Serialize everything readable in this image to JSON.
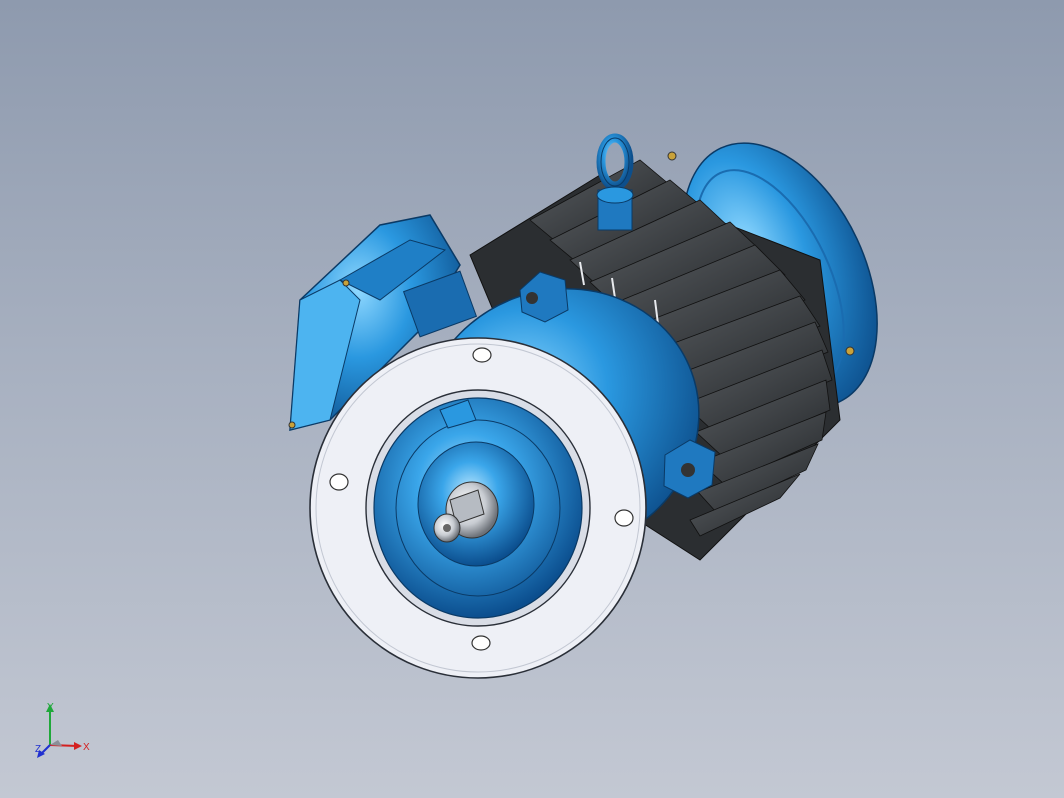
{
  "viewport": {
    "background_top": "#8e9aae",
    "background_bottom": "#c3c8d3"
  },
  "model": {
    "body_color": "#2a8fd6",
    "body_highlight": "#6cc6f5",
    "fin_color": "#3a3d40",
    "flange_color": "#eef0f6",
    "shaft_color": "#cfd3d8",
    "components": [
      "flange",
      "fan-cover",
      "cooling-fins",
      "terminal-box",
      "lifting-eye",
      "shaft",
      "bearing-cap",
      "mounting-holes"
    ]
  },
  "triad": {
    "x_label": "X",
    "y_label": "Y",
    "z_label": "Z",
    "x_color": "#d42020",
    "y_color": "#1fa83a",
    "z_color": "#2030d0"
  }
}
